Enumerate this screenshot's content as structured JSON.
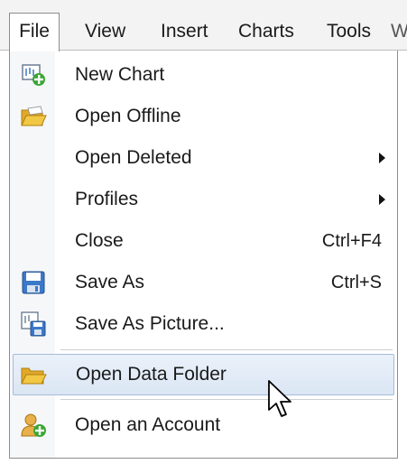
{
  "menubar": {
    "items": [
      {
        "label": "File",
        "active": true
      },
      {
        "label": "View"
      },
      {
        "label": "Insert"
      },
      {
        "label": "Charts"
      },
      {
        "label": "Tools"
      },
      {
        "label": "W"
      }
    ]
  },
  "file_menu": {
    "items": [
      {
        "label": "New Chart",
        "icon": "new-chart-icon"
      },
      {
        "label": "Open Offline",
        "icon": "open-folder-icon"
      },
      {
        "label": "Open Deleted",
        "submenu": true
      },
      {
        "label": "Profiles",
        "submenu": true
      },
      {
        "label": "Close",
        "shortcut": "Ctrl+F4"
      },
      {
        "label": "Save As",
        "shortcut": "Ctrl+S",
        "icon": "floppy-disk-icon"
      },
      {
        "label": "Save As Picture...",
        "icon": "save-picture-icon"
      },
      {
        "label": "Open Data Folder",
        "icon": "folder-icon",
        "highlighted": true
      },
      {
        "label": "Open an Account",
        "icon": "add-account-icon"
      }
    ]
  },
  "colors": {
    "highlight_fill": "#dbe6f4",
    "highlight_border": "#a6bcd9",
    "folder_yellow": "#f2c744",
    "icon_green": "#3aa635",
    "icon_blue": "#3c78c8"
  }
}
